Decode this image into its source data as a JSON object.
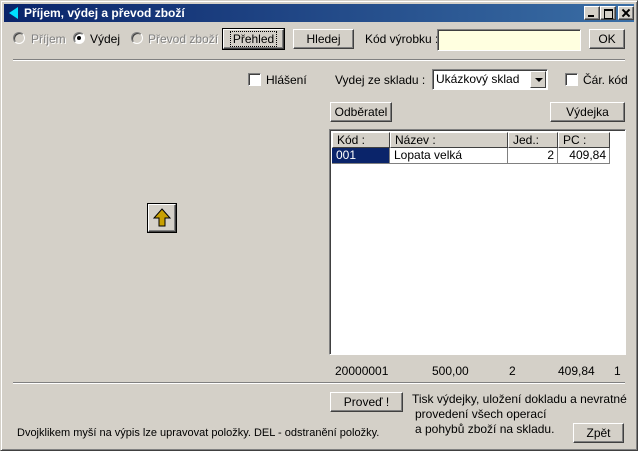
{
  "window": {
    "title": "Příjem, výdej a převod zboží"
  },
  "toolbar": {
    "radio_prijem": "Příjem",
    "radio_vydej": "Výdej",
    "radio_prevod": "Převod zboží",
    "selected_mode": "Výdej",
    "prehled_label": "Přehled",
    "hledej_label": "Hledej",
    "kod_vyrobku_label": "Kód výrobku :",
    "kod_vyrobku_value": "",
    "ok_label": "OK"
  },
  "options": {
    "hlaseni_label": "Hlášení",
    "hlaseni_checked": false,
    "sklad_label": "Vydej ze skladu :",
    "sklad_value": "Ukázkový sklad",
    "car_kod_label": "Čár. kód",
    "car_kod_checked": false,
    "odberatel_label": "Odběratel",
    "vydejka_label": "Výdejka"
  },
  "grid": {
    "columns": [
      "Kód :",
      "Název :",
      "Jed.:",
      "PC :"
    ],
    "rows": [
      [
        "001",
        "Lopata velká",
        "2",
        "409,84"
      ]
    ]
  },
  "summary": {
    "doc_number": "20000001",
    "total": "500,00",
    "qty": "2",
    "pc_total": "409,84",
    "count": "1"
  },
  "footer": {
    "proved_label": "Proveď !",
    "proved_desc_1": "Tisk výdejky, uložení dokladu a nevratné",
    "proved_desc_2": "provedení všech operací",
    "proved_desc_3": "a pohybů zboží na skladu.",
    "hint": "Dvojklikem myší na výpis lze upravovat položky. DEL - odstranění položky.",
    "zpet_label": "Zpět"
  },
  "colors": {
    "title_bar": "#0a246a",
    "selection": "#0a246a",
    "input_bg": "#ffffe0",
    "arrow_icon": "#c8a000"
  }
}
